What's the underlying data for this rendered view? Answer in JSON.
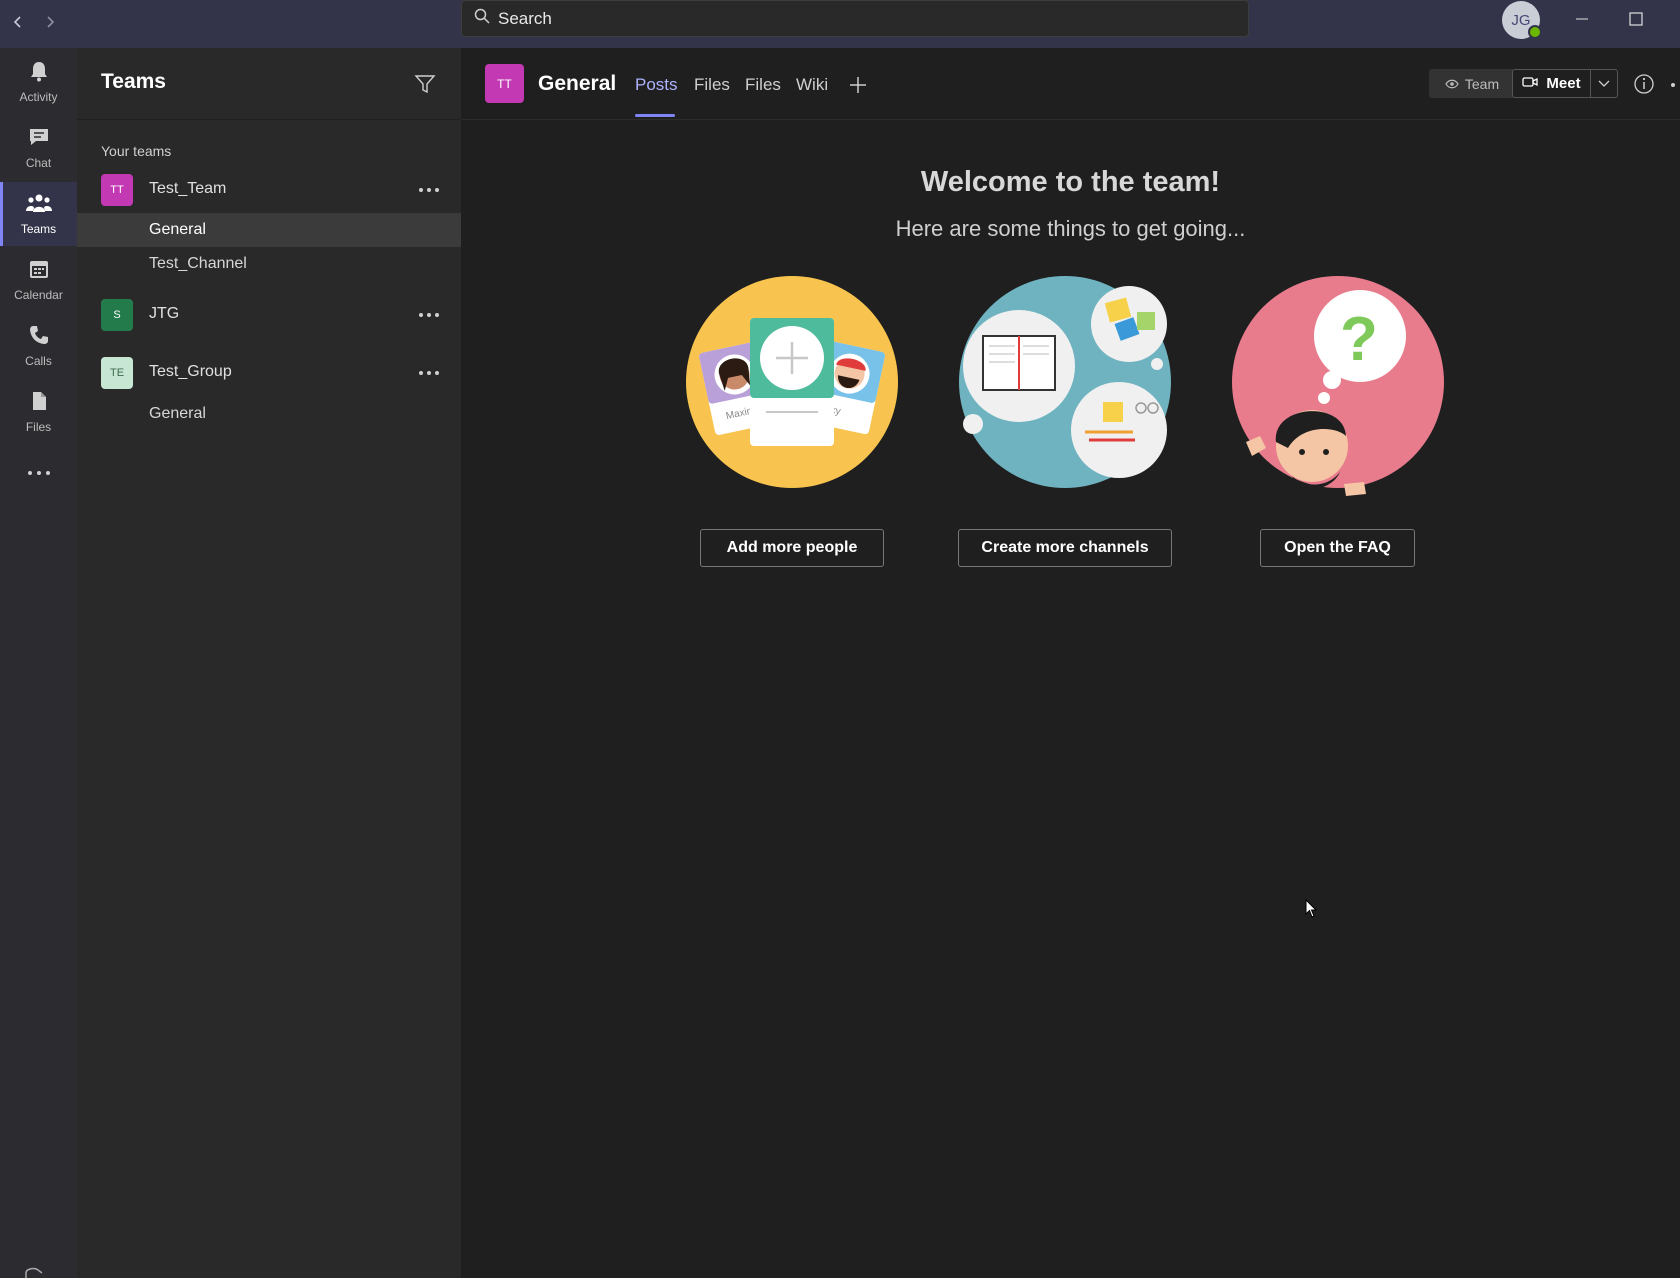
{
  "titlebar": {
    "search_placeholder": "Search",
    "user_initials": "JG"
  },
  "rail": {
    "items": [
      {
        "label": "Activity",
        "icon": "bell-icon"
      },
      {
        "label": "Chat",
        "icon": "chat-icon"
      },
      {
        "label": "Teams",
        "icon": "teams-icon",
        "active": true
      },
      {
        "label": "Calendar",
        "icon": "calendar-icon"
      },
      {
        "label": "Calls",
        "icon": "phone-icon"
      },
      {
        "label": "Files",
        "icon": "file-icon"
      }
    ]
  },
  "panel": {
    "title": "Teams",
    "section_label": "Your teams",
    "teams": [
      {
        "initials": "TT",
        "name": "Test_Team",
        "color": "#c239b3",
        "channels": [
          "General",
          "Test_Channel"
        ],
        "selected_channel": "General"
      },
      {
        "initials": "S",
        "name": "JTG",
        "color": "#237b4b",
        "channels": []
      },
      {
        "initials": "TE",
        "name": "Test_Group",
        "color": "#c8e6d4",
        "channels": [
          "General"
        ]
      }
    ]
  },
  "channel_header": {
    "avatar_initials": "TT",
    "title": "General",
    "tabs": [
      "Posts",
      "Files",
      "Files",
      "Wiki"
    ],
    "active_tab": "Posts",
    "team_label": "Team",
    "meet_label": "Meet"
  },
  "welcome": {
    "title": "Welcome to the team!",
    "subtitle": "Here are some things to get going...",
    "actions": [
      {
        "label": "Add more people",
        "illustration": "people-cards-illustration",
        "color": "#f8c44f"
      },
      {
        "label": "Create more channels",
        "illustration": "channels-illustration",
        "color": "#6fb3c0"
      },
      {
        "label": "Open the FAQ",
        "illustration": "faq-illustration",
        "color": "#e87c8c"
      }
    ],
    "illustration_text": {
      "card_name_1": "Maxine",
      "card_name_2": "ky"
    }
  },
  "colors": {
    "accent": "#7f85f5",
    "titlebar": "#33344a",
    "rail": "#2b2b30",
    "panel": "#292929",
    "main": "#1f1f1f"
  }
}
